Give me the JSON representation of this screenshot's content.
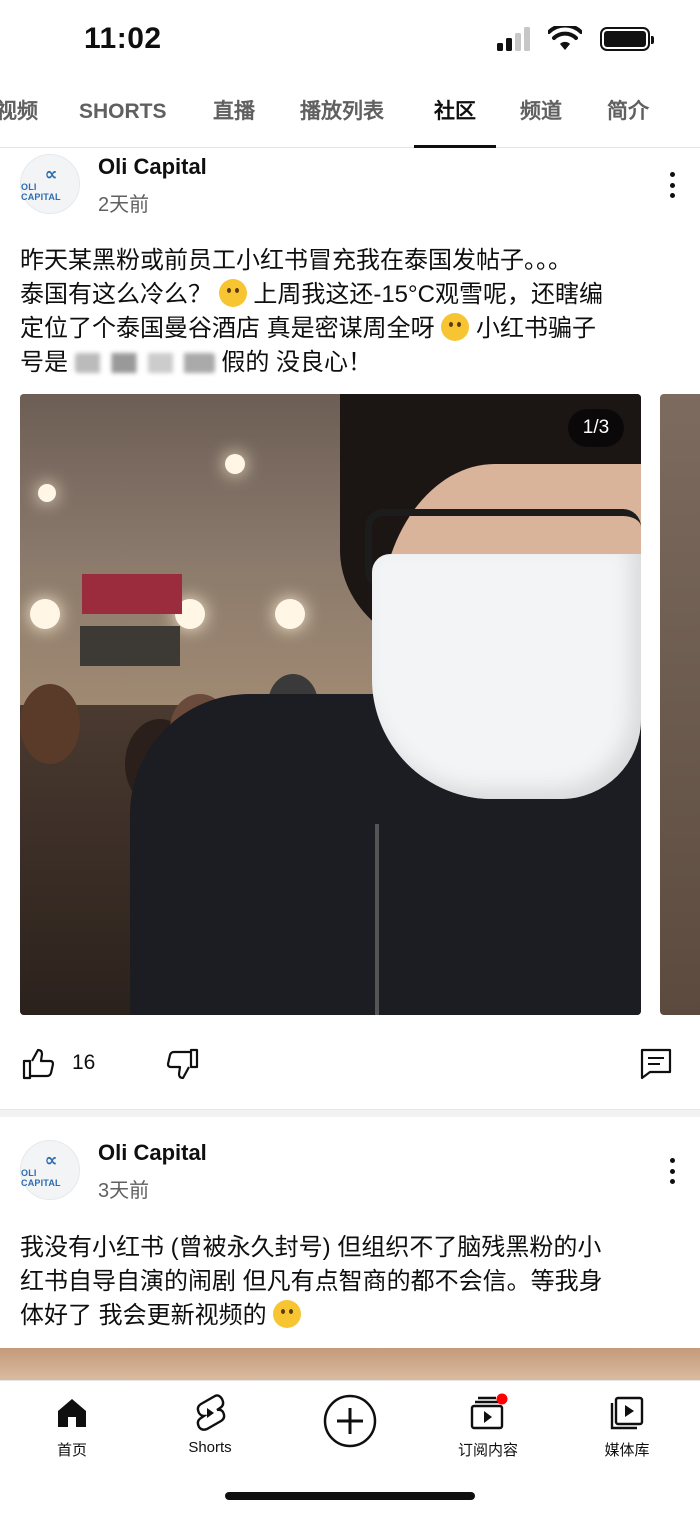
{
  "status_bar": {
    "time": "11:02",
    "signal_icon": "cellular-signal-icon",
    "wifi_icon": "wifi-icon",
    "battery_icon": "battery-icon"
  },
  "tabs": [
    {
      "label": "视频",
      "active": false
    },
    {
      "label": "SHORTS",
      "active": false
    },
    {
      "label": "直播",
      "active": false
    },
    {
      "label": "播放列表",
      "active": false
    },
    {
      "label": "社区",
      "active": true
    },
    {
      "label": "频道",
      "active": false
    },
    {
      "label": "简介",
      "active": false
    }
  ],
  "posts": [
    {
      "channel_name": "Oli Capital",
      "avatar_text": "OLI CAPITAL",
      "avatar_mark": "∝",
      "time": "2天前",
      "text": {
        "line1": "昨天某黑粉或前员工小红书冒充我在泰国发帖子。。。",
        "line2_a": "泰国有这么冷么？",
        "line2_b": " 上周我这还-15°C观雪呢，还瞎编",
        "line3_a": "定位了个泰国曼谷酒店 真是密谋周全呀",
        "line3_b": " 小红书骗子",
        "line4_a": "号是",
        "line4_b": "假的 没良心！"
      },
      "image_counter": "1/3",
      "likes": "16"
    },
    {
      "channel_name": "Oli Capital",
      "avatar_text": "OLI CAPITAL",
      "avatar_mark": "∝",
      "time": "3天前",
      "text": {
        "line1": "我没有小红书 (曾被永久封号) 但组织不了脑残黑粉的小",
        "line2": "红书自导自演的闹剧 但凡有点智商的都不会信。等我身",
        "line3": "体好了 我会更新视频的"
      }
    }
  ],
  "bottom_nav": [
    {
      "label": "首页",
      "icon": "home-icon"
    },
    {
      "label": "Shorts",
      "icon": "shorts-icon"
    },
    {
      "label": "",
      "icon": "create-plus-icon"
    },
    {
      "label": "订阅内容",
      "icon": "subscriptions-icon"
    },
    {
      "label": "媒体库",
      "icon": "library-icon"
    }
  ],
  "colors": {
    "text_primary": "#0f0f0f",
    "text_secondary": "#606060",
    "notification_dot": "#ff0000"
  }
}
